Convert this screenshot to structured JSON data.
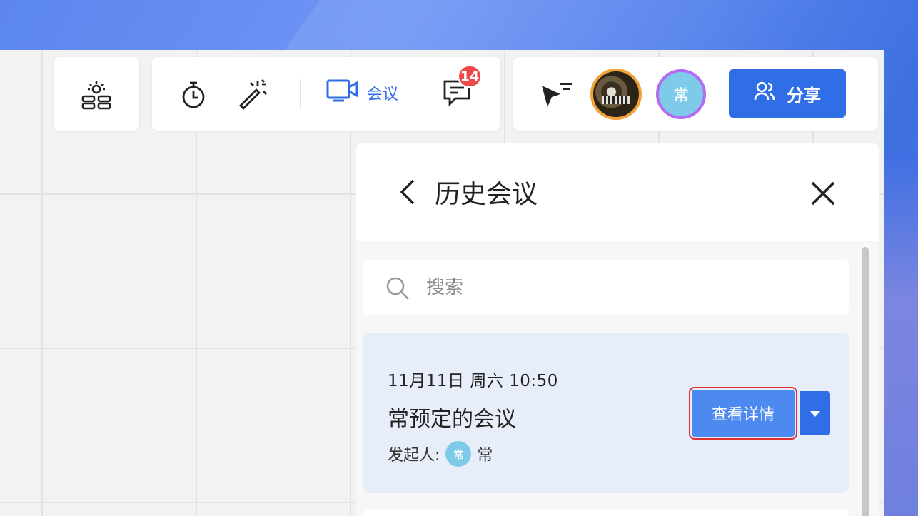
{
  "toolbar": {
    "left": {
      "icons": [
        "team-icon"
      ]
    },
    "middle": {
      "icons": [
        "timer-icon",
        "magic-wand-icon"
      ],
      "meeting_label": "会议",
      "comment_badge": "14"
    },
    "right": {
      "avatar_letter": "常",
      "share_label": "分享"
    }
  },
  "panel": {
    "title": "历史会议",
    "search_placeholder": "搜索",
    "meetings": [
      {
        "date": "11月11日  周六  10:50",
        "title": "常预定的会议",
        "initiator_label": "发起人:",
        "initiator_avatar": "常",
        "initiator_name": "常",
        "details_label": "查看详情"
      }
    ]
  },
  "colors": {
    "accent": "#2f6ee6",
    "badge": "#f04848",
    "card_bg": "#e7edf9",
    "highlight_outline": "#e03030"
  }
}
